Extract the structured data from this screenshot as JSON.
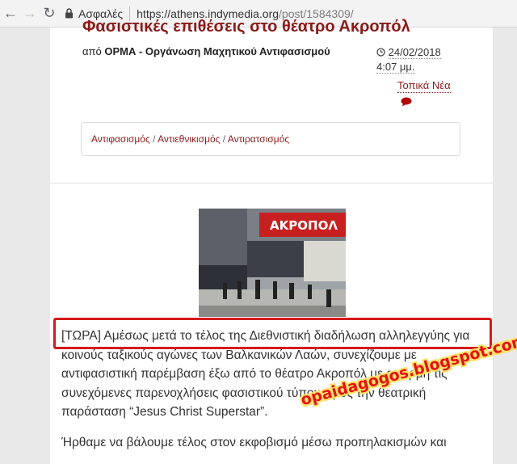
{
  "browser": {
    "secure_label": "Ασφαλές",
    "url_host": "https://athens.indymedia.org",
    "url_path": "/post/1584309/"
  },
  "post": {
    "title_cut": "Φασιστικές επιθέσεις στο θέατρο Ακροπόλ",
    "by_prefix": "από",
    "author": "ΟΡΜΑ - Οργάνωση Μαχητικού Αντιφασισμού",
    "date": "24/02/2018",
    "time": "4:07 μμ.",
    "category": "Τοπικά Νέα",
    "tags": [
      "Αντιφασισμός",
      "Αντιεθνικισμός",
      "Αντιρατσισμός"
    ],
    "tag_separator": " / "
  },
  "photo": {
    "sign_text": "ΑΚΡΟΠΟΛ"
  },
  "article": {
    "p1": "[ΤΩΡΑ] Αμέσως μετά το τέλος της Διεθνιστική διαδήλωση αλληλεγγύης για κοινούς ταξικούς αγώνες των Βαλκανικών Λαών, συνεχίζουμε με αντιφασιστική παρέμβαση έξω από το θέατρο Ακροπόλ με αφορμή τις συνεχόμενες παρενοχλήσεις φασιστικού τύπου προς την θεατρική παράσταση “Jesus Christ Superstar”.",
    "p2": "Ήρθαμε να βάλουμε τέλος στον εκφοβισμό μέσω προπηλακισμών και"
  },
  "watermark": "opaidagogos.blogspot.com",
  "colors": {
    "accent": "#8b1a1a",
    "highlight": "#d61a1a",
    "watermark": "#e51313"
  }
}
